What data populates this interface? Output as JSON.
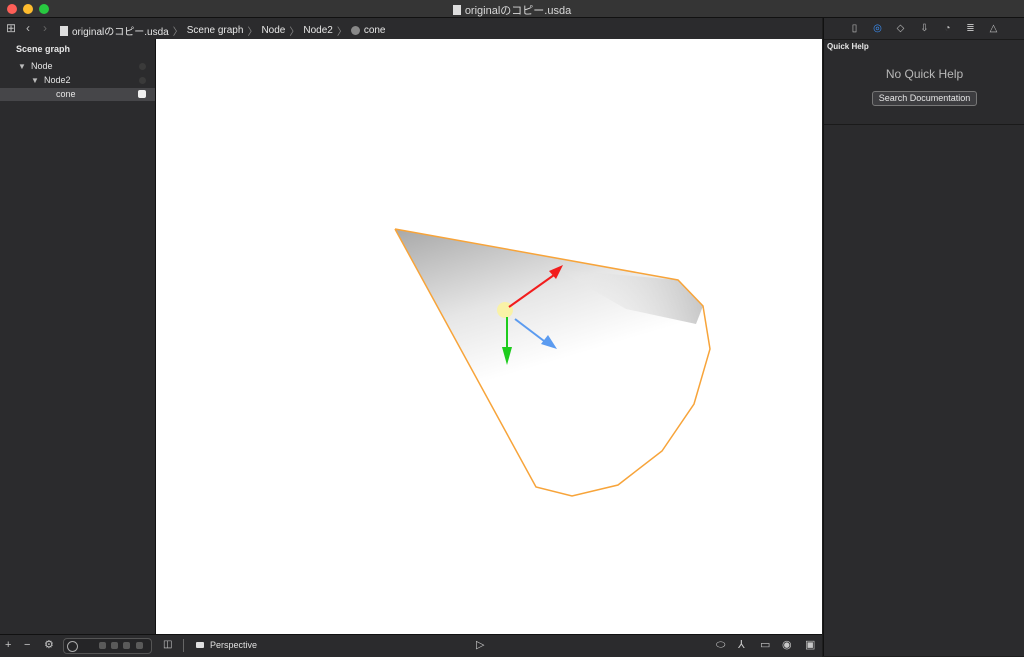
{
  "window": {
    "title": "originalのコピー.usda"
  },
  "navbar": {
    "breadcrumbs": [
      "originalのコピー.usda",
      "Scene graph",
      "Node",
      "Node2",
      "cone"
    ],
    "icons": [
      "grid-icon",
      "back-chevron-icon",
      "forward-chevron-icon"
    ]
  },
  "sidebar": {
    "title": "Scene graph",
    "tree": [
      {
        "label": "Node",
        "level": 0,
        "expanded": true
      },
      {
        "label": "Node2",
        "level": 1,
        "expanded": true
      },
      {
        "label": "cone",
        "level": 2,
        "selected": true
      }
    ]
  },
  "inspector": {
    "tabs": [
      "file-icon",
      "quick-help-icon",
      "cube-icon",
      "anchor-icon",
      "material-icon",
      "align-icon",
      "physics-icon"
    ],
    "active_tab": "quick-help-icon",
    "quick_help_title": "Quick Help",
    "no_help_text": "No Quick Help",
    "search_button": "Search Documentation"
  },
  "bottombar": {
    "add_label": "+",
    "remove_label": "−",
    "camera_label": "Perspective"
  },
  "colors": {
    "selection_outline": "#f7a43a",
    "axis_x": "#f21d1d",
    "axis_y": "#1dcc1d",
    "axis_z": "#5b9bf0",
    "active_tab": "#3b8ff6"
  }
}
